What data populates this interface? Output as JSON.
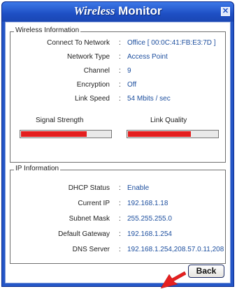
{
  "window": {
    "title_part1": "Wireless",
    "title_part2": "Monitor",
    "close_glyph": "✕"
  },
  "wireless_info": {
    "title": "Wireless Information",
    "rows": [
      {
        "label": "Connect To Network",
        "value": "Office [ 00:0C:41:FB:E3:7D ]"
      },
      {
        "label": "Network Type",
        "value": "Access Point"
      },
      {
        "label": "Channel",
        "value": "9"
      },
      {
        "label": "Encryption",
        "value": "Off"
      },
      {
        "label": "Link Speed",
        "value": "54 Mbits / sec"
      }
    ],
    "signal_strength": {
      "label": "Signal Strength",
      "level": 0.74
    },
    "link_quality": {
      "label": "Link Quality",
      "level": 0.71
    }
  },
  "ip_info": {
    "title": "IP Information",
    "rows": [
      {
        "label": "DHCP Status",
        "value": "Enable"
      },
      {
        "label": "Current IP",
        "value": "192.168.1.18"
      },
      {
        "label": "Subnet Mask",
        "value": "255.255.255.0"
      },
      {
        "label": "Default Gateway",
        "value": "192.168.1.254"
      },
      {
        "label": "DNS Server",
        "value": "192.168.1.254,208.57.0.11,208"
      }
    ]
  },
  "buttons": {
    "back": "Back"
  },
  "colors": {
    "title_bar": "#1e4fc4",
    "value_text": "#1c4e9e",
    "meter_fill": "#e41f1f",
    "arrow": "#e62020"
  }
}
